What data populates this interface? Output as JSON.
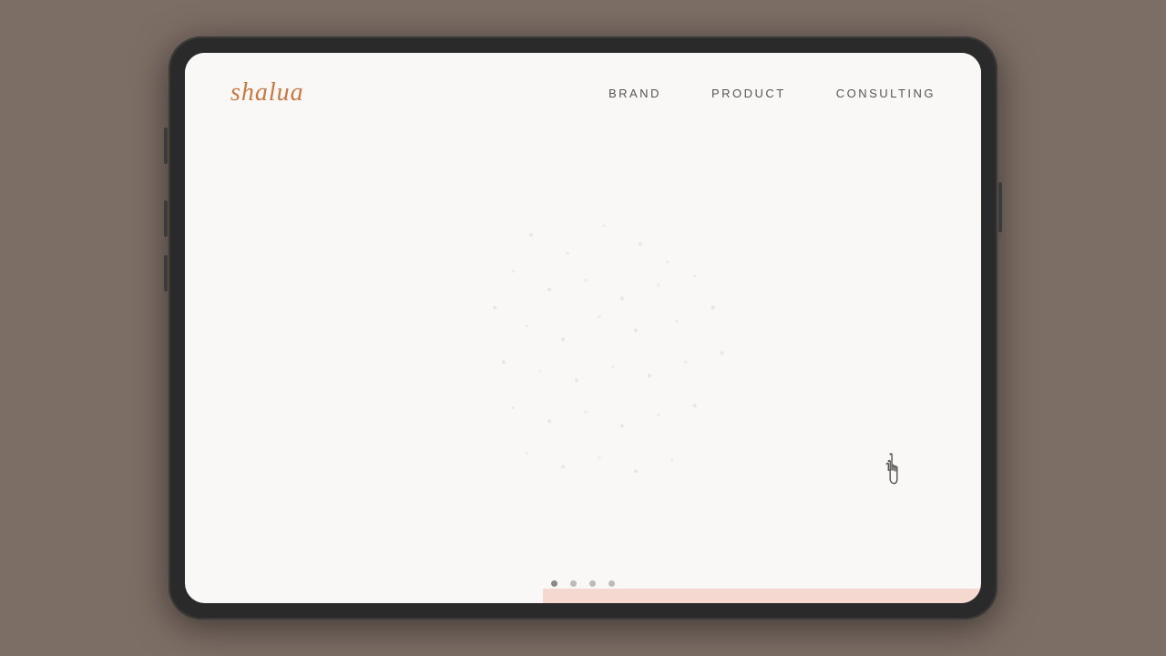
{
  "background_color": "#7d6e65",
  "tablet": {
    "outer_color": "#2a2a2a",
    "screen_color": "#faf8f6"
  },
  "nav": {
    "logo": "shalua",
    "links": [
      {
        "label": "BRAND",
        "id": "brand"
      },
      {
        "label": "PRODUCT",
        "id": "product"
      },
      {
        "label": "CONSULTING",
        "id": "consulting"
      }
    ]
  },
  "pagination": {
    "dots": [
      {
        "id": 1,
        "active": true
      },
      {
        "id": 2,
        "active": false
      },
      {
        "id": 3,
        "active": false
      },
      {
        "id": 4,
        "active": false
      }
    ]
  },
  "bottom_bar_color": "#f5d8d0",
  "accent_color": "#c87941"
}
